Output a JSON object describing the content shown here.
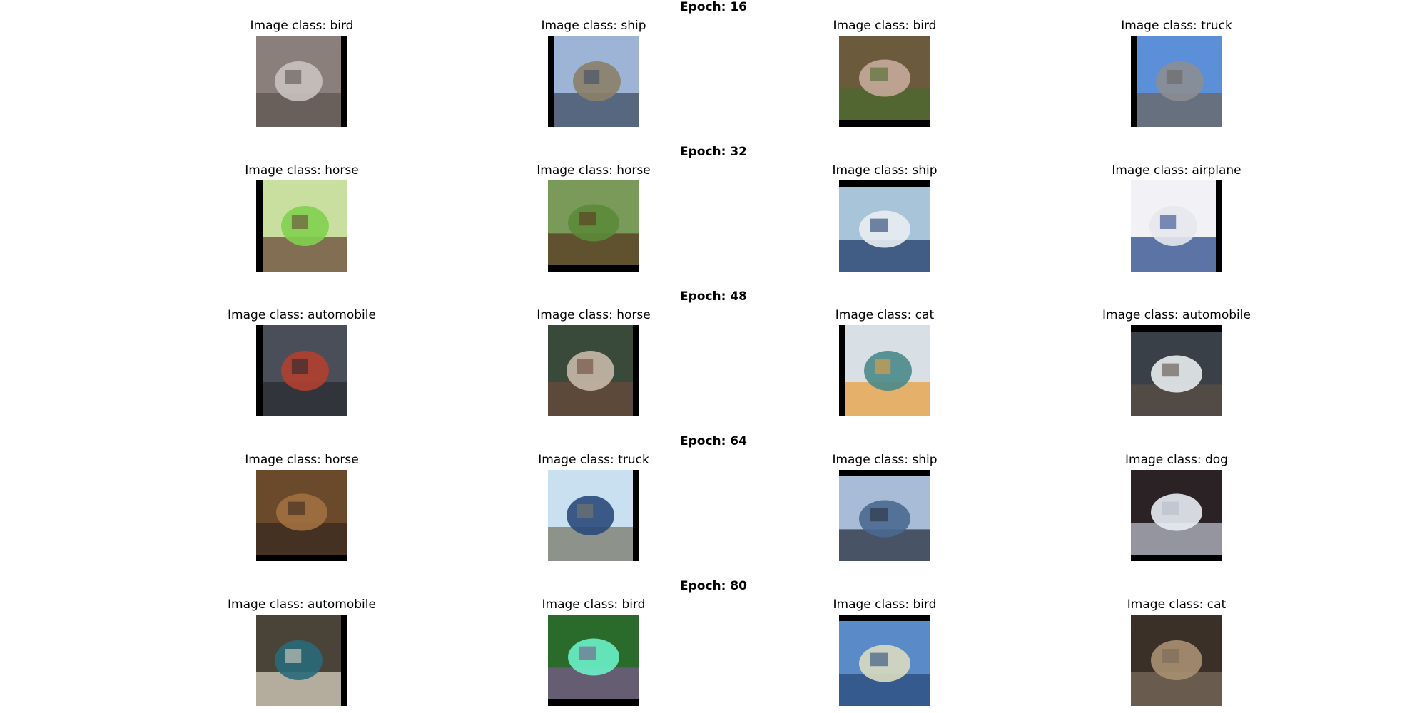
{
  "sections": [
    {
      "title": "Epoch: 16",
      "cells": [
        {
          "caption": "Image class: bird",
          "icon": "bird-thumbnail",
          "colors": [
            "#8a7f7b",
            "#c9c2be",
            "#5e5450"
          ],
          "shift": "right"
        },
        {
          "caption": "Image class: ship",
          "icon": "ship-thumbnail",
          "colors": [
            "#9db4d6",
            "#8c7f68",
            "#3f4e62"
          ],
          "shift": "left"
        },
        {
          "caption": "Image class: bird",
          "icon": "bird-thumbnail",
          "colors": [
            "#6b5a3c",
            "#c7a89a",
            "#4a6b2e"
          ],
          "shift": "bottom"
        },
        {
          "caption": "Image class: truck",
          "icon": "truck-thumbnail",
          "colors": [
            "#5b8fd8",
            "#8b8e94",
            "#6b6660"
          ],
          "shift": "left"
        }
      ]
    },
    {
      "title": "Epoch: 32",
      "cells": [
        {
          "caption": "Image class: horse",
          "icon": "horse-thumbnail",
          "colors": [
            "#c8dfa0",
            "#7fd04f",
            "#6b4a3a"
          ],
          "shift": "left"
        },
        {
          "caption": "Image class: horse",
          "icon": "horse-thumbnail",
          "colors": [
            "#7a9a5a",
            "#5c8a3a",
            "#5a3a22"
          ],
          "shift": "bottom"
        },
        {
          "caption": "Image class: ship",
          "icon": "ship-thumbnail",
          "colors": [
            "#a8c4d8",
            "#e8eef2",
            "#1f3a6a"
          ],
          "shift": "top"
        },
        {
          "caption": "Image class: airplane",
          "icon": "airplane-thumbnail",
          "colors": [
            "#f2f2f6",
            "#e6e8ee",
            "#2a4a8a"
          ],
          "shift": "right"
        }
      ]
    },
    {
      "title": "Epoch: 48",
      "cells": [
        {
          "caption": "Image class: automobile",
          "icon": "automobile-thumbnail",
          "colors": [
            "#4a4e58",
            "#b04030",
            "#2a2c32"
          ],
          "shift": "left"
        },
        {
          "caption": "Image class: horse",
          "icon": "horse-thumbnail",
          "colors": [
            "#3a4a3a",
            "#c8b8a8",
            "#6a4a3a"
          ],
          "shift": "right"
        },
        {
          "caption": "Image class: cat",
          "icon": "cat-thumbnail",
          "colors": [
            "#d8e0e6",
            "#4a8a8a",
            "#e8a040"
          ],
          "shift": "left"
        },
        {
          "caption": "Image class: automobile",
          "icon": "automobile-thumbnail",
          "colors": [
            "#3a4048",
            "#e8ecee",
            "#5a4e44"
          ],
          "shift": "top"
        }
      ]
    },
    {
      "title": "Epoch: 64",
      "cells": [
        {
          "caption": "Image class: horse",
          "icon": "horse-thumbnail",
          "colors": [
            "#6a4a2a",
            "#a07040",
            "#3a2a20"
          ],
          "shift": "bottom"
        },
        {
          "caption": "Image class: truck",
          "icon": "truck-thumbnail",
          "colors": [
            "#c8e0f0",
            "#2a4a7a",
            "#7a7a6a"
          ],
          "shift": "right"
        },
        {
          "caption": "Image class: ship",
          "icon": "ship-thumbnail",
          "colors": [
            "#a8bcd8",
            "#4a6890",
            "#2a3040"
          ],
          "shift": "top"
        },
        {
          "caption": "Image class: dog",
          "icon": "dog-thumbnail",
          "colors": [
            "#2a2224",
            "#e8ecf4",
            "#b8bcc8"
          ],
          "shift": "bottom"
        }
      ]
    },
    {
      "title": "Epoch: 80",
      "cells": [
        {
          "caption": "Image class: automobile",
          "icon": "automobile-thumbnail",
          "colors": [
            "#4a4438",
            "#2a6a7a",
            "#d8d0c0"
          ],
          "shift": "right"
        },
        {
          "caption": "Image class: bird",
          "icon": "bird-thumbnail",
          "colors": [
            "#2a6a2a",
            "#6af0c8",
            "#7a5a8a"
          ],
          "shift": "bottom"
        },
        {
          "caption": "Image class: bird",
          "icon": "bird-thumbnail",
          "colors": [
            "#5a8ac8",
            "#d8dcc0",
            "#2a4a7a"
          ],
          "shift": "top"
        },
        {
          "caption": "Image class: cat",
          "icon": "cat-thumbnail",
          "colors": [
            "#3a3028",
            "#a89070",
            "#7a6a5a"
          ],
          "shift": "none"
        }
      ]
    }
  ]
}
